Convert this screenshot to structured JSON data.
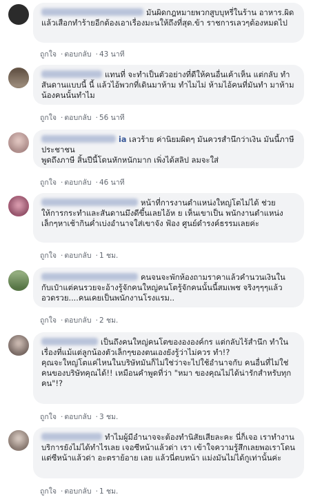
{
  "comments": [
    {
      "name": "",
      "text": "มันผิดกฎหมายพวกสูบบุหรี่ในร้าน อาหาร.ผิดแล้วเสือกทำร้ายอีกต้องเอาเรื่องมะนให้ถึงที่สุด.ข้า ราชการเลวๆต้องหมดไป",
      "like": "ถูกใจ",
      "reply": "ตอบกลับ",
      "time": "43 นาที"
    },
    {
      "name": "",
      "text": "แทนที่ จะทำเป็นตัวอย่างที่ดีให้คนอื่นเค้าเห็น แต่กลับ ทำสันดานแบบนี้ นี้ แล้วไอ้พวกที่เดินมาห้าม ทำไมไม่ ห้ามไอ้คนที่มันทำ มาห้ามน้องคนนั้นทำไม",
      "like": "ถูกใจ",
      "reply": "ตอบกลับ",
      "time": "56 นาที"
    },
    {
      "name": "ia",
      "text": "เลวร้าย ค่านิยมผิดๆ มันควรสำนึกว่าเงิน มันนี้ภาษีประชาชน\nพูดถึงภาษี สิ้นปีนี้โดนหักหนักมาก เพิ่งได้สลิป ลมจะใส่",
      "like": "ถูกใจ",
      "reply": "ตอบกลับ",
      "time": "46 นาที"
    },
    {
      "name": "",
      "text": "หน้าที่การงานตำแหน่งใหญ่โตไม่ได้ ช่วยให้การกระทำและสันดานมึงดีขึ้นเลยไอ้ห ย เห็นเขาเป็น พนักงานตำแหน่งเล็กๆหาเช้ากินค่ำเบ่งอำนาจใส่เขาจัง ฟ้อง ศูนย์ดำรงค์ธรรมเลยค่ะ",
      "like": "ถูกใจ",
      "reply": "ตอบกลับ",
      "time": "1 ชม."
    },
    {
      "name": "",
      "text": "คนจนจะพักห้องถามราคาแล้วคำนวนเงินใน กับเป๋าแต่คนรวยจะอ้างรู้จักคนใหญ่คนโตรู้จักคนนั้นนี้สมเพช จริงๆๆๆแล้วอวดรวย....คนเคยเป็นพนักงานโรงแรม..",
      "like": "ถูกใจ",
      "reply": "ตอบกลับ",
      "time": "2 ชม."
    },
    {
      "name": "",
      "text": "เป็นถึงคนใหญ่คนโตของององค์กร แต่กลับไร้สำนึก ทำในเรื่องที่แม้แต่ลูกน้องตัวเล็กๆของตนเองยังรู้ว่าไม่ควร ทำ!?\nคุณจะใหญ่โตแค่ไหนในบริษัทมันก็ไม่ใช่ว่าจะไปใช้อำนาจกับ คนอื่นที่ไม่ใช่คนของบริษัทคุณได้!! เหมือนคำพูดที่ว่า \"หมา ของคุณไม่ได้น่ารักสำหรับทุกคน\"!?",
      "like": "ถูกใจ",
      "reply": "ตอบกลับ",
      "time": "3 ชม."
    },
    {
      "name": "",
      "text": "ทำไมผู้มีอำนาจจะต้องทำนิสัยเสียละคะ นี่ก็เจอ เราทำงานบริการยังไม่ได้ทำไรเลย เจอซีหน้าแล้วด่า เรา เข้าใจความรู้สึกเลยพอเราโดนแต่ซีหน้าแล้วด่า อะตราย้อาย เลย แล้วนี่ตบหน้า แม่งมันไม่ได้กูเท่านั้นค่ะ",
      "like": "ถูกใจ",
      "reply": "ตอบกลับ",
      "time": "1 ชม."
    }
  ],
  "colors": {
    "bubble": "#f2f3f5",
    "name": "#385898",
    "meta": "#616770"
  }
}
